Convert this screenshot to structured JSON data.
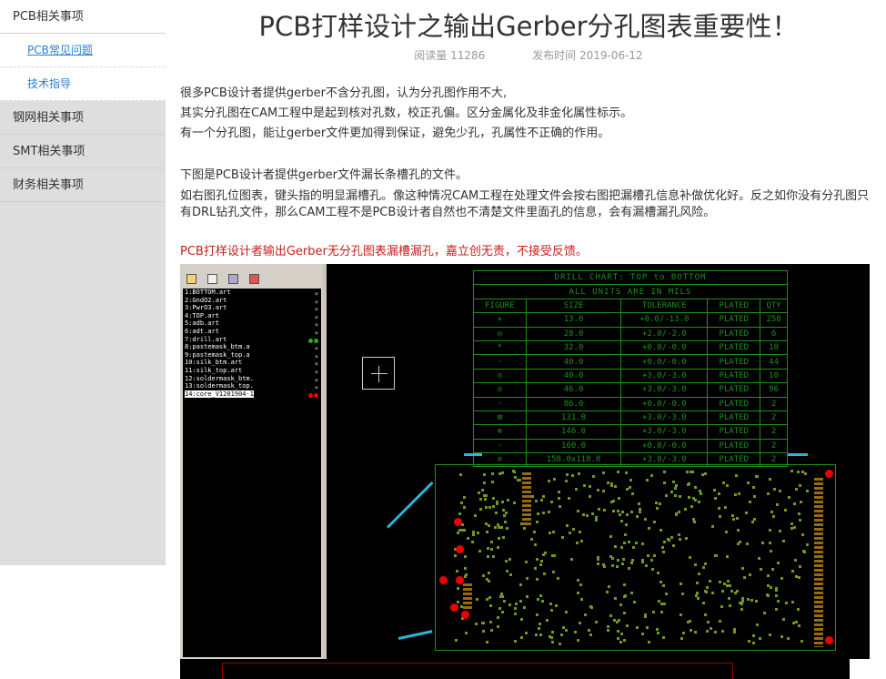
{
  "sidebar": {
    "items": [
      {
        "label": "PCB相关事项"
      },
      {
        "label": "PCB常见问题"
      },
      {
        "label": "技术指导"
      },
      {
        "label": "钢网相关事项"
      },
      {
        "label": "SMT相关事项"
      },
      {
        "label": "财务相关事项"
      }
    ]
  },
  "article": {
    "title": "PCB打样设计之输出Gerber分孔图表重要性！",
    "reads": "阅读量 11286",
    "published": "发布时间 2019-06-12",
    "para1": [
      "很多PCB设计者提供gerber不含分孔图，认为分孔图作用不大,",
      "其实分孔图在CAM工程中是起到核对孔数，校正孔偏。区分金属化及非金化属性标示。",
      "有一个分孔图，能让gerber文件更加得到保证，避免少孔，孔属性不正确的作用。"
    ],
    "para2": [
      "下图是PCB设计者提供gerber文件漏长条槽孔的文件。",
      "如右图孔位图表，键头指的明显漏槽孔。像这种情况CAM工程在处理文件会按右图把漏槽孔信息补做优化好。反之如你没有分孔图只有DRL钻孔文件，那么CAM工程不是PCB设计者自然也不清楚文件里面孔的信息，会有漏槽漏孔风险。"
    ],
    "warning": "PCB打样设计者输出Gerber无分孔图表漏槽漏孔，嘉立创无责，不接受反馈。"
  },
  "cam": {
    "files": [
      "1:BOTTOM.art",
      "2:GndO2.art",
      "3:PwrO3.art",
      "4:TOP.art",
      "5:adb.art",
      "6:adt.art",
      "7:drill.art",
      "8:pastemask_btm.a",
      "9:pastemask_top.a",
      "10:silk_btm.art",
      "11:silk_top.art",
      "12:soldermask_btm.",
      "13:soldermask_top.",
      "14:core_V1201904-1"
    ],
    "drill_title": "DRILL CHART: TOP to BOTTOM",
    "drill_units": "ALL UNITS ARE IN MILS",
    "drill_headers": [
      "FIGURE",
      "SIZE",
      "TOLERANCE",
      "PLATED",
      "QTY"
    ],
    "drill_rows": [
      [
        "+",
        "13.0",
        "+0.0/-13.0",
        "PLATED",
        "258"
      ],
      [
        "◎",
        "28.0",
        "+2.0/-2.0",
        "PLATED",
        "6"
      ],
      [
        "*",
        "32.0",
        "+0.0/-0.0",
        "PLATED",
        "10"
      ],
      [
        "·",
        "40.0",
        "+0.0/-0.0",
        "PLATED",
        "44"
      ],
      [
        "◎",
        "40.0",
        "+3.0/-3.0",
        "PLATED",
        "10"
      ],
      [
        "◎",
        "46.0",
        "+3.0/-3.0",
        "PLATED",
        "96"
      ],
      [
        "·",
        "86.0",
        "+0.0/-0.0",
        "PLATED",
        "2"
      ],
      [
        "⊠",
        "131.0",
        "+3.0/-3.0",
        "PLATED",
        "2"
      ],
      [
        "⊕",
        "146.0",
        "+3.0/-3.0",
        "PLATED",
        "2"
      ],
      [
        "·",
        "160.0",
        "+0.0/-0.0",
        "PLATED",
        "2"
      ],
      [
        "⊘",
        "158.0x118.0",
        "+3.0/-3.0",
        "PLATED",
        "2"
      ]
    ],
    "colors": {
      "trace": "#1e8f1e",
      "pad": "#e00000",
      "arrow": "#2bb6d6"
    }
  }
}
